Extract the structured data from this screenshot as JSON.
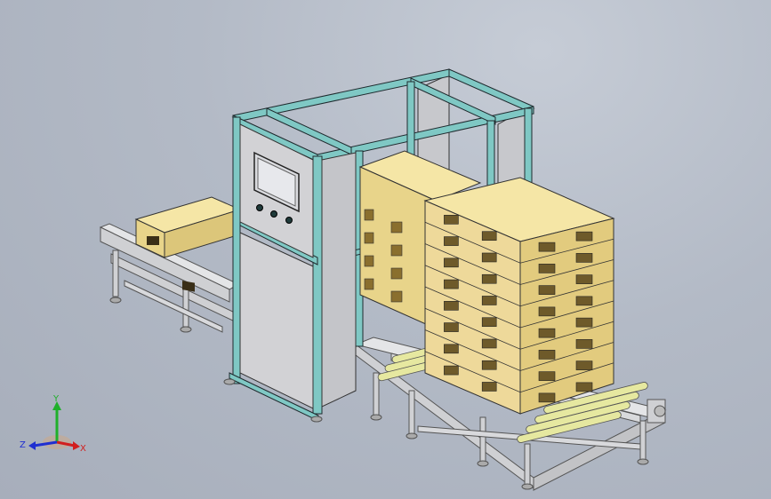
{
  "viewport": {
    "title": "",
    "background_top": "#c6ccd6",
    "background_bottom": "#a7aebb"
  },
  "colors": {
    "frame_teal": "#7fc8c4",
    "frame_dark": "#1f2a2e",
    "panel_grey": "#c9c9cc",
    "pallet_wood": "#f2e2a0",
    "pallet_dark": "#c9b46a",
    "roller": "#e8ea9e",
    "conveyor_steel": "#d6d7d9"
  },
  "triad": {
    "x_label": "X",
    "y_label": "Y",
    "z_label": "Z",
    "x_color": "#d11f1f",
    "y_color": "#1fb02a",
    "z_color": "#1f2fd1"
  },
  "machine": {
    "control_panel_buttons": 3,
    "button_color": "#1f3a3a"
  }
}
